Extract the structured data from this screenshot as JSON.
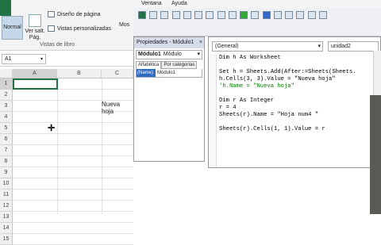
{
  "excel": {
    "ribbon": {
      "normal_label": "Normal",
      "page_break_label": "Ver salt.\nPág.",
      "page_layout_label": "Diseño de página",
      "custom_views_label": "Vistas personalizadas",
      "group_label": "Vistas de libro",
      "show_label": "Mos"
    },
    "name_box": "A1",
    "columns": [
      "A",
      "B",
      "C"
    ],
    "rows": [
      "1",
      "2",
      "3",
      "4",
      "5",
      "6",
      "7",
      "8",
      "9",
      "10",
      "11",
      "12",
      "13",
      "14",
      "15"
    ],
    "cell_c3": "Nueva hoja"
  },
  "vbe": {
    "menu": [
      "Ventana",
      "Ayuda"
    ],
    "props": {
      "title": "Propiedades - Módulo1",
      "close": "×",
      "combo_name": "Módulo1",
      "combo_type": "Módulo",
      "tab_alpha": "Alfabética",
      "tab_cat": "Por categorías",
      "name_key": "(Name)",
      "name_value": "Módulo1"
    },
    "code": {
      "combo_left": "(General)",
      "combo_right": "unidad2",
      "lines": [
        "Dim h As Worksheet",
        "",
        "Set h = Sheets.Add(After:=Sheets(Sheets.",
        "h.Cells(3, 3).Value = \"Nueva hoja\"",
        "'h.Name = \"Nueva hoja\"",
        "",
        "Dim r As Integer",
        "r = 4",
        "Sheets(r).Name = \"Hoja num4 \"",
        "",
        "Sheets(r).Cells(1, 1).Value = r"
      ]
    }
  }
}
